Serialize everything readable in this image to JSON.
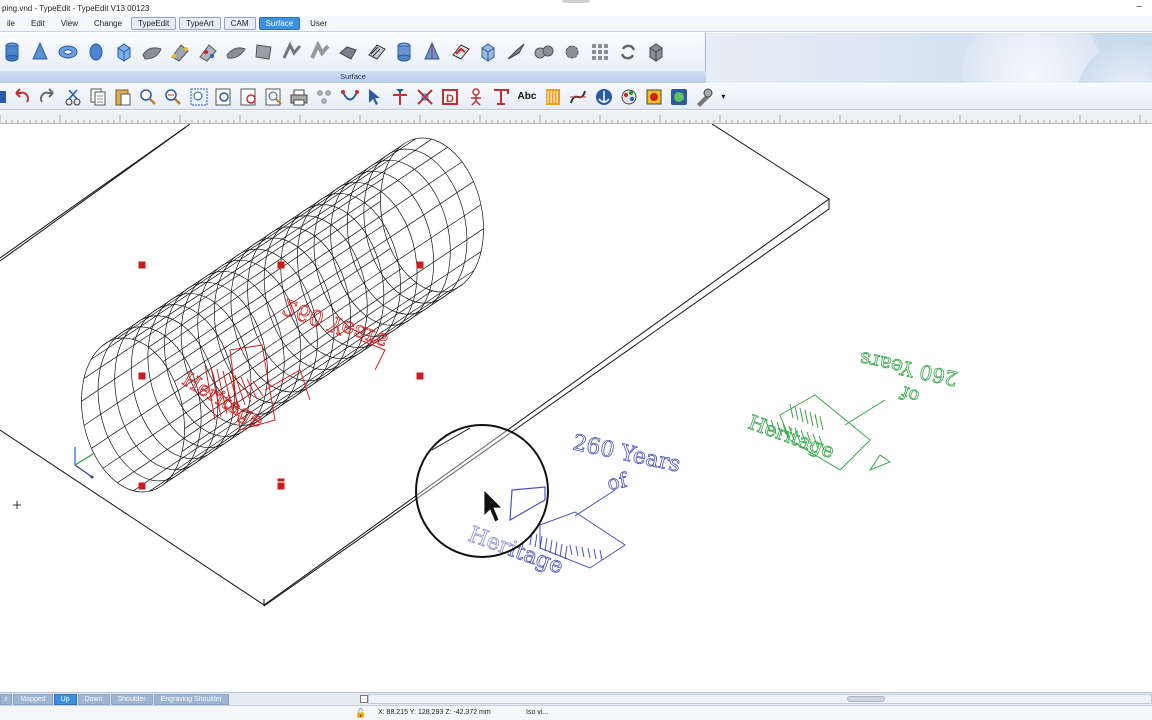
{
  "window": {
    "title": "ping.vnd - TypeEdit  - TypeEdit V13 00123",
    "minimize": "–"
  },
  "menu": {
    "items": [
      {
        "label": "ile",
        "style": "plain"
      },
      {
        "label": "Edit",
        "style": "plain"
      },
      {
        "label": "View",
        "style": "plain"
      },
      {
        "label": "Change",
        "style": "plain"
      },
      {
        "label": "TypeEdit",
        "style": "tab"
      },
      {
        "label": "TypeArt",
        "style": "tab"
      },
      {
        "label": "CAM",
        "style": "tab"
      },
      {
        "label": "Surface",
        "style": "active"
      },
      {
        "label": "User",
        "style": "plain"
      }
    ]
  },
  "ribbon": {
    "label": "Surface"
  },
  "toolbar": {
    "text_tool_label": "Abc",
    "dropdown_arrow": "▾"
  },
  "canvas": {
    "text_front": {
      "line1": "260 Years",
      "line2": "of",
      "line3": "Heritage"
    },
    "text_flat": {
      "line1": "260 Years",
      "line2": "of",
      "line3": "Heritage"
    },
    "text_wrapped": {
      "line1": "Heritage",
      "line2": "260 Years"
    },
    "colors": {
      "mesh": "#111111",
      "wrapped": "#d62020",
      "blue_text": "#4a55b8",
      "green_text": "#37a64a",
      "handle": "#cc1b1b"
    }
  },
  "mode_tabs": [
    {
      "label": "r",
      "active": false
    },
    {
      "label": "Mapped",
      "active": false
    },
    {
      "label": "Up",
      "active": true
    },
    {
      "label": "Down",
      "active": false
    },
    {
      "label": "Shoulder",
      "active": false
    },
    {
      "label": "Engraving Shoulder",
      "active": false
    }
  ],
  "status": {
    "coords": "X: 88.215   Y: 128.293   Z: -42.372 mm",
    "view": "Iso vi..."
  }
}
